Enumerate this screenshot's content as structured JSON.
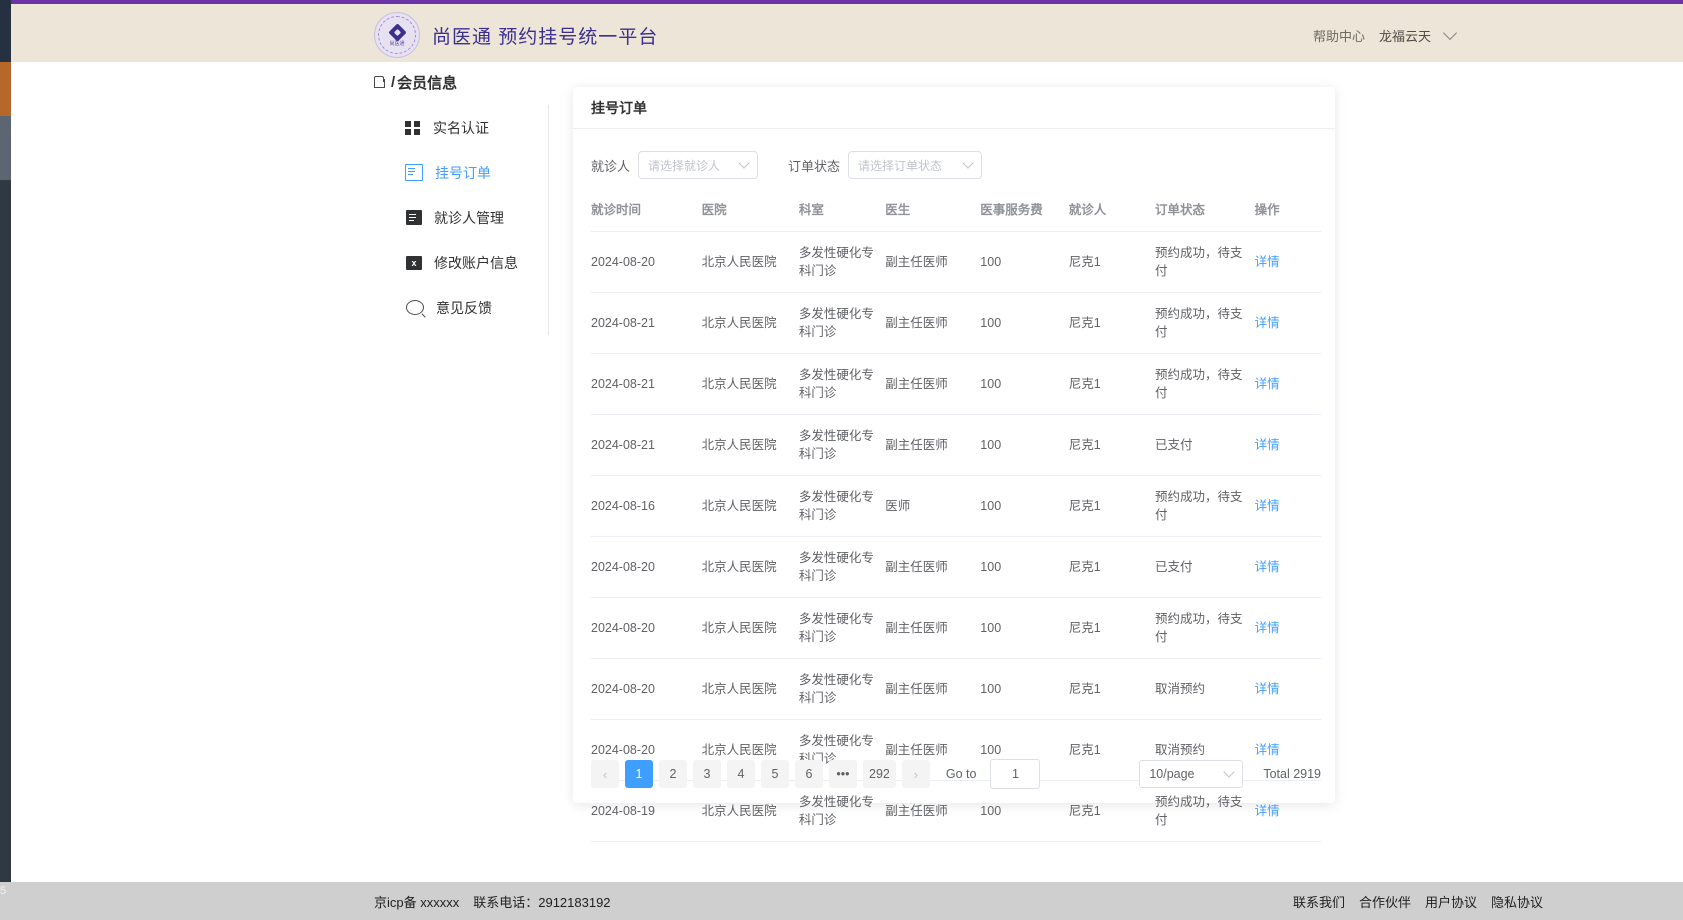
{
  "desktop": {
    "edge_label": "5"
  },
  "header": {
    "brand_title": "尚医通 预约挂号统一平台",
    "logo_text": "尚医通",
    "help_center": "帮助中心",
    "user_name": "龙福云天",
    "chevron_icon": "chevron-down-icon"
  },
  "breadcrumb": {
    "home_icon": "home-icon",
    "separator": "/",
    "current": "会员信息"
  },
  "sidebar": {
    "items": [
      {
        "label": "实名认证",
        "icon": "grid-icon",
        "active": false
      },
      {
        "label": "挂号订单",
        "icon": "document-icon",
        "active": true
      },
      {
        "label": "就诊人管理",
        "icon": "clipboard-icon",
        "active": false
      },
      {
        "label": "修改账户信息",
        "icon": "account-edit-icon",
        "active": false
      },
      {
        "label": "意见反馈",
        "icon": "search-icon",
        "active": false
      }
    ]
  },
  "card": {
    "title": "挂号订单",
    "filters": [
      {
        "label": "就诊人",
        "placeholder": "请选择就诊人",
        "value": ""
      },
      {
        "label": "订单状态",
        "placeholder": "请选择订单状态",
        "value": ""
      }
    ],
    "table": {
      "columns": [
        "就诊时间",
        "医院",
        "科室",
        "医生",
        "医事服务费",
        "就诊人",
        "订单状态",
        "操作"
      ],
      "action_label": "详情",
      "rows": [
        {
          "time": "2024-08-20",
          "hospital": "北京人民医院",
          "dept": "多发性硬化专科门诊",
          "doctor": "副主任医师",
          "fee": "100",
          "patient": "尼克1",
          "status": "预约成功，待支付"
        },
        {
          "time": "2024-08-21",
          "hospital": "北京人民医院",
          "dept": "多发性硬化专科门诊",
          "doctor": "副主任医师",
          "fee": "100",
          "patient": "尼克1",
          "status": "预约成功，待支付"
        },
        {
          "time": "2024-08-21",
          "hospital": "北京人民医院",
          "dept": "多发性硬化专科门诊",
          "doctor": "副主任医师",
          "fee": "100",
          "patient": "尼克1",
          "status": "预约成功，待支付"
        },
        {
          "time": "2024-08-21",
          "hospital": "北京人民医院",
          "dept": "多发性硬化专科门诊",
          "doctor": "副主任医师",
          "fee": "100",
          "patient": "尼克1",
          "status": "已支付"
        },
        {
          "time": "2024-08-16",
          "hospital": "北京人民医院",
          "dept": "多发性硬化专科门诊",
          "doctor": "医师",
          "fee": "100",
          "patient": "尼克1",
          "status": "预约成功，待支付"
        },
        {
          "time": "2024-08-20",
          "hospital": "北京人民医院",
          "dept": "多发性硬化专科门诊",
          "doctor": "副主任医师",
          "fee": "100",
          "patient": "尼克1",
          "status": "已支付"
        },
        {
          "time": "2024-08-20",
          "hospital": "北京人民医院",
          "dept": "多发性硬化专科门诊",
          "doctor": "副主任医师",
          "fee": "100",
          "patient": "尼克1",
          "status": "预约成功，待支付"
        },
        {
          "time": "2024-08-20",
          "hospital": "北京人民医院",
          "dept": "多发性硬化专科门诊",
          "doctor": "副主任医师",
          "fee": "100",
          "patient": "尼克1",
          "status": "取消预约"
        },
        {
          "time": "2024-08-20",
          "hospital": "北京人民医院",
          "dept": "多发性硬化专科门诊",
          "doctor": "副主任医师",
          "fee": "100",
          "patient": "尼克1",
          "status": "取消预约"
        },
        {
          "time": "2024-08-19",
          "hospital": "北京人民医院",
          "dept": "多发性硬化专科门诊",
          "doctor": "副主任医师",
          "fee": "100",
          "patient": "尼克1",
          "status": "预约成功，待支付"
        }
      ]
    },
    "pagination": {
      "prev_icon": "chevron-left-icon",
      "next_icon": "chevron-right-icon",
      "pages": [
        "1",
        "2",
        "3",
        "4",
        "5",
        "6",
        "•••",
        "292"
      ],
      "current_page": "1",
      "goto_label": "Go to",
      "goto_value": "1",
      "page_size": "10/page",
      "total": "Total 2919"
    }
  },
  "footer": {
    "icp": "京icp备 xxxxxx",
    "phone": "联系电话：2912183192",
    "links": [
      "联系我们",
      "合作伙伴",
      "用户协议",
      "隐私协议"
    ]
  },
  "colors": {
    "accent": "#409eff",
    "brand": "#3b2f8f",
    "header_bg": "#ece5d8",
    "purple_rule": "#6b33a8",
    "footer_bg": "#cfcfcf"
  }
}
